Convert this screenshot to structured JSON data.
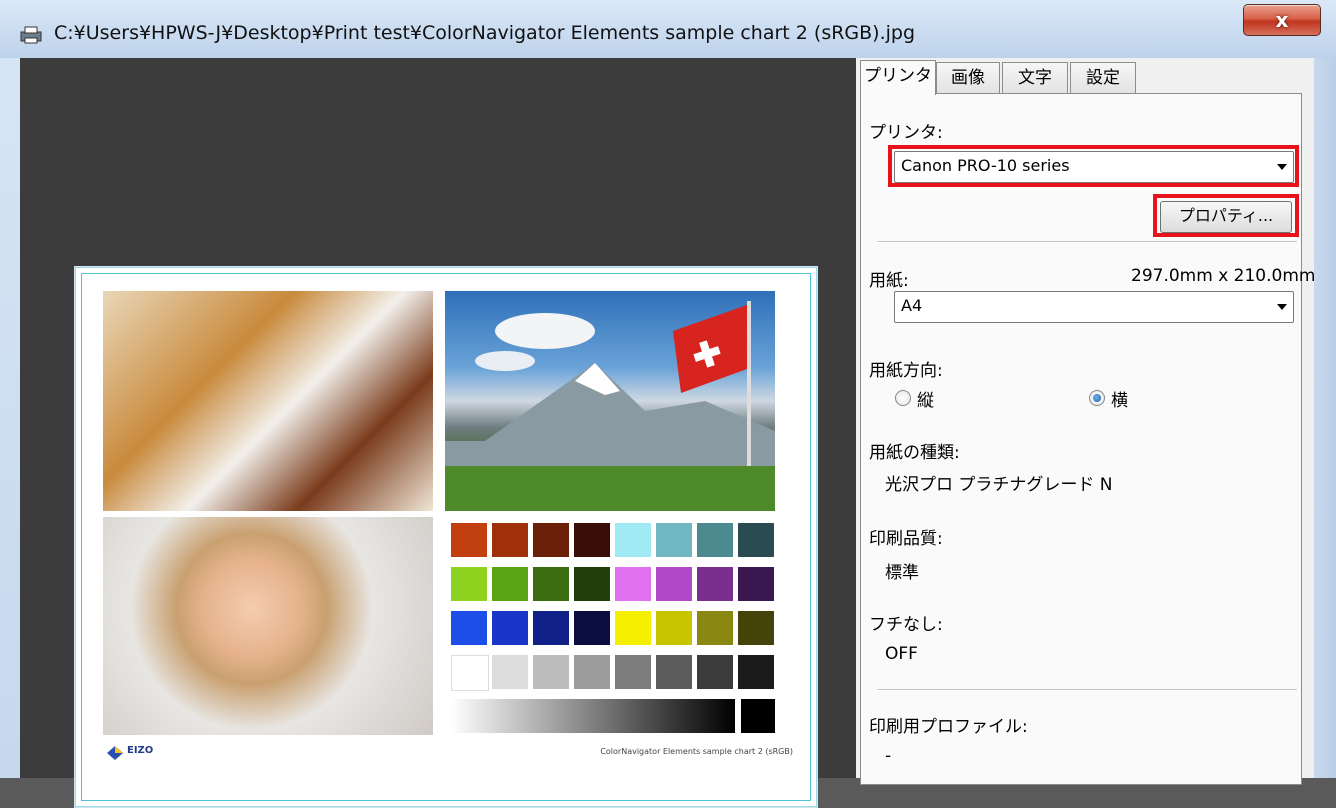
{
  "window": {
    "title": "C:¥Users¥HPWS-J¥Desktop¥Print test¥ColorNavigator Elements sample chart 2 (sRGB).jpg",
    "close_label": "x"
  },
  "preview": {
    "logo_text": "EIZO",
    "caption": "ColorNavigator Elements sample chart 2 (sRGB)"
  },
  "tabs": [
    {
      "label": "プリンタ"
    },
    {
      "label": "画像"
    },
    {
      "label": "文字"
    },
    {
      "label": "設定"
    }
  ],
  "printer": {
    "label": "プリンタ:",
    "selected": "Canon PRO-10 series",
    "properties_button": "プロパティ..."
  },
  "paper": {
    "label": "用紙:",
    "dimensions": "297.0mm x 210.0mm",
    "selected": "A4"
  },
  "orientation": {
    "label": "用紙方向:",
    "portrait": "縦",
    "landscape": "横",
    "selected": "landscape"
  },
  "paper_type": {
    "label": "用紙の種類:",
    "value": "光沢プロ プラチナグレード N"
  },
  "quality": {
    "label": "印刷品質:",
    "value": "標準"
  },
  "borderless": {
    "label": "フチなし:",
    "value": "OFF"
  },
  "profile": {
    "label": "印刷用プロファイル:",
    "value": "-"
  },
  "colors": {
    "highlight": "#e8121b",
    "swatches": [
      [
        "#c2400f",
        "#a0300a",
        "#6a2008",
        "#3a0c06",
        "#9fe9f3",
        "#6fb8c2",
        "#4d8a8f",
        "#2a4c50"
      ],
      [
        "#8cd21e",
        "#5aa514",
        "#3a6e10",
        "#223e0a",
        "#e070ee",
        "#b048c8",
        "#7a2e8e",
        "#3c1850"
      ],
      [
        "#1e4ee8",
        "#1a36c8",
        "#12208a",
        "#0a0e40",
        "#f6f000",
        "#c8c400",
        "#8a8810",
        "#44440a"
      ],
      [
        "#ffffff",
        "#dcdcdc",
        "#bcbcbc",
        "#9c9c9c",
        "#7c7c7c",
        "#5c5c5c",
        "#3c3c3c",
        "#1c1c1c"
      ]
    ]
  }
}
